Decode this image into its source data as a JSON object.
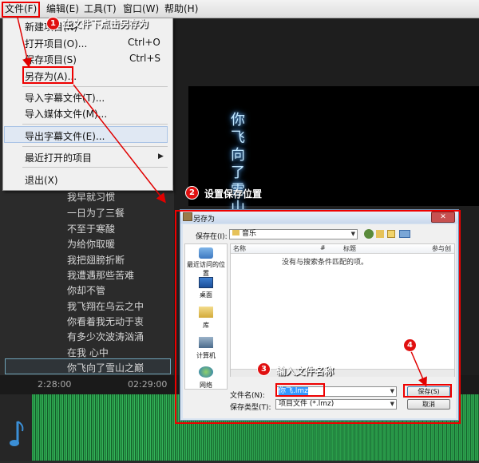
{
  "menubar": {
    "items": [
      "文件(F)",
      "编辑(E)",
      "工具(T)",
      "窗口(W)",
      "帮助(H)"
    ]
  },
  "file_menu": {
    "new_project": "新建项目(N)",
    "open_project": "打开项目(O)...",
    "open_shortcut": "Ctrl+O",
    "save_project": "保存项目(S)",
    "save_shortcut": "Ctrl+S",
    "save_as": "另存为(A)...",
    "import_subtitle": "导入字幕文件(T)...",
    "import_media": "导入媒体文件(M)...",
    "export_subtitle": "导出字幕文件(E)...",
    "recent": "最近打开的项目",
    "exit": "退出(X)"
  },
  "preview": {
    "vertical_text": [
      "你",
      "飞",
      "向",
      "了",
      "雪",
      "山"
    ]
  },
  "lyrics": [
    "我早就习惯",
    "一日为了三餐",
    "不至于寒酸",
    "为给你取暖",
    "我把翅膀折断",
    "我遭遇那些苦难",
    "你却不管",
    "我飞翔在乌云之中",
    "你看着我无动于衷",
    "有多少次波涛汹涌",
    "在我  心中",
    "你飞向了雪山之巅"
  ],
  "timeline": {
    "ticks": [
      "2:28:00",
      "02:29:00"
    ]
  },
  "dialog": {
    "title": "另存为",
    "save_in_label": "保存在(I):",
    "folder": "音乐",
    "places": [
      "最近访问的位置",
      "桌面",
      "库",
      "计算机",
      "网络"
    ],
    "columns": [
      "名称",
      "#",
      "标题",
      "参与创"
    ],
    "empty_message": "没有与搜索条件匹配的项。",
    "filename_label": "文件名(N):",
    "filename_value": "你飞.lmz",
    "filetype_label": "保存类型(T):",
    "filetype_value": "项目文件 (*.lmz)",
    "save_button": "保存(S)",
    "cancel_button": "取消"
  },
  "annotations": {
    "step1": {
      "num": "1",
      "text": "在文件下点击另存为"
    },
    "step2": {
      "num": "2",
      "text": "设置保存位置"
    },
    "step3": {
      "num": "3",
      "text": "输入文件名称"
    },
    "step4": {
      "num": "4"
    }
  },
  "colors": {
    "annotation_red": "#e00000",
    "waveform_green": "#2a9c4a",
    "menu_bg": "#f0f0f0"
  }
}
